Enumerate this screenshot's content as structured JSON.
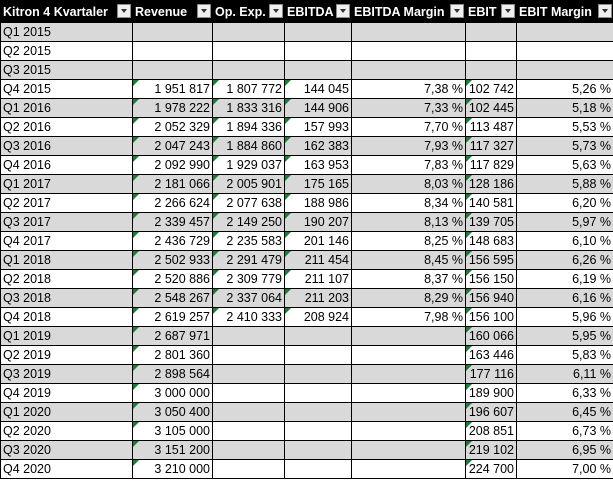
{
  "headers": [
    "Kitron 4 Kvartaler",
    "Revenue",
    "Op. Exp.",
    "EBITDA",
    "EBITDA Margin",
    "EBIT",
    "EBIT Margin"
  ],
  "rows": [
    {
      "q": "Q1 2015",
      "rev": "",
      "opex": "",
      "ebitda": "",
      "ebitda_m": "",
      "ebit": "",
      "ebit_m": ""
    },
    {
      "q": "Q2 2015",
      "rev": "",
      "opex": "",
      "ebitda": "",
      "ebitda_m": "",
      "ebit": "",
      "ebit_m": ""
    },
    {
      "q": "Q3 2015",
      "rev": "",
      "opex": "",
      "ebitda": "",
      "ebitda_m": "",
      "ebit": "",
      "ebit_m": ""
    },
    {
      "q": "Q4 2015",
      "rev": "1 951 817",
      "opex": "1 807 772",
      "ebitda": "144 045",
      "ebitda_m": "7,38 %",
      "ebit": "102 742",
      "ebit_m": "5,26 %"
    },
    {
      "q": "Q1 2016",
      "rev": "1 978 222",
      "opex": "1 833 316",
      "ebitda": "144 906",
      "ebitda_m": "7,33 %",
      "ebit": "102 445",
      "ebit_m": "5,18 %"
    },
    {
      "q": "Q2 2016",
      "rev": "2 052 329",
      "opex": "1 894 336",
      "ebitda": "157 993",
      "ebitda_m": "7,70 %",
      "ebit": "113 487",
      "ebit_m": "5,53 %"
    },
    {
      "q": "Q3 2016",
      "rev": "2 047 243",
      "opex": "1 884 860",
      "ebitda": "162 383",
      "ebitda_m": "7,93 %",
      "ebit": "117 327",
      "ebit_m": "5,73 %"
    },
    {
      "q": "Q4 2016",
      "rev": "2 092 990",
      "opex": "1 929 037",
      "ebitda": "163 953",
      "ebitda_m": "7,83 %",
      "ebit": "117 829",
      "ebit_m": "5,63 %"
    },
    {
      "q": "Q1 2017",
      "rev": "2 181 066",
      "opex": "2 005 901",
      "ebitda": "175 165",
      "ebitda_m": "8,03 %",
      "ebit": "128 186",
      "ebit_m": "5,88 %"
    },
    {
      "q": "Q2 2017",
      "rev": "2 266 624",
      "opex": "2 077 638",
      "ebitda": "188 986",
      "ebitda_m": "8,34 %",
      "ebit": "140 581",
      "ebit_m": "6,20 %"
    },
    {
      "q": "Q3 2017",
      "rev": "2 339 457",
      "opex": "2 149 250",
      "ebitda": "190 207",
      "ebitda_m": "8,13 %",
      "ebit": "139 705",
      "ebit_m": "5,97 %"
    },
    {
      "q": "Q4 2017",
      "rev": "2 436 729",
      "opex": "2 235 583",
      "ebitda": "201 146",
      "ebitda_m": "8,25 %",
      "ebit": "148 683",
      "ebit_m": "6,10 %"
    },
    {
      "q": "Q1 2018",
      "rev": "2 502 933",
      "opex": "2 291 479",
      "ebitda": "211 454",
      "ebitda_m": "8,45 %",
      "ebit": "156 595",
      "ebit_m": "6,26 %"
    },
    {
      "q": "Q2 2018",
      "rev": "2 520 886",
      "opex": "2 309 779",
      "ebitda": "211 107",
      "ebitda_m": "8,37 %",
      "ebit": "156 150",
      "ebit_m": "6,19 %"
    },
    {
      "q": "Q3 2018",
      "rev": "2 548 267",
      "opex": "2 337 064",
      "ebitda": "211 203",
      "ebitda_m": "8,29 %",
      "ebit": "156 940",
      "ebit_m": "6,16 %"
    },
    {
      "q": "Q4 2018",
      "rev": "2 619 257",
      "opex": "2 410 333",
      "ebitda": "208 924",
      "ebitda_m": "7,98 %",
      "ebit": "156 100",
      "ebit_m": "5,96 %"
    },
    {
      "q": "Q1 2019",
      "rev": "2 687 971",
      "opex": "",
      "ebitda": "",
      "ebitda_m": "",
      "ebit": "160 066",
      "ebit_m": "5,95 %"
    },
    {
      "q": "Q2 2019",
      "rev": "2 801 360",
      "opex": "",
      "ebitda": "",
      "ebitda_m": "",
      "ebit": "163 446",
      "ebit_m": "5,83 %"
    },
    {
      "q": "Q3 2019",
      "rev": "2 898 564",
      "opex": "",
      "ebitda": "",
      "ebitda_m": "",
      "ebit": "177 116",
      "ebit_m": "6,11 %"
    },
    {
      "q": "Q4 2019",
      "rev": "3 000 000",
      "opex": "",
      "ebitda": "",
      "ebitda_m": "",
      "ebit": "189 900",
      "ebit_m": "6,33 %"
    },
    {
      "q": "Q1 2020",
      "rev": "3 050 400",
      "opex": "",
      "ebitda": "",
      "ebitda_m": "",
      "ebit": "196 607",
      "ebit_m": "6,45 %"
    },
    {
      "q": "Q2 2020",
      "rev": "3 105 000",
      "opex": "",
      "ebitda": "",
      "ebitda_m": "",
      "ebit": "208 851",
      "ebit_m": "6,73 %"
    },
    {
      "q": "Q3 2020",
      "rev": "3 151 200",
      "opex": "",
      "ebitda": "",
      "ebitda_m": "",
      "ebit": "219 102",
      "ebit_m": "6,95 %"
    },
    {
      "q": "Q4 2020",
      "rev": "3 210 000",
      "opex": "",
      "ebitda": "",
      "ebitda_m": "",
      "ebit": "224 700",
      "ebit_m": "7,00 %"
    }
  ],
  "flagged_columns": [
    "rev",
    "opex",
    "ebitda",
    "ebit"
  ],
  "flag_color": "#1e7b34",
  "band_color": "#d9d9d9",
  "header_bg": "#000000",
  "header_fg": "#ffffff"
}
